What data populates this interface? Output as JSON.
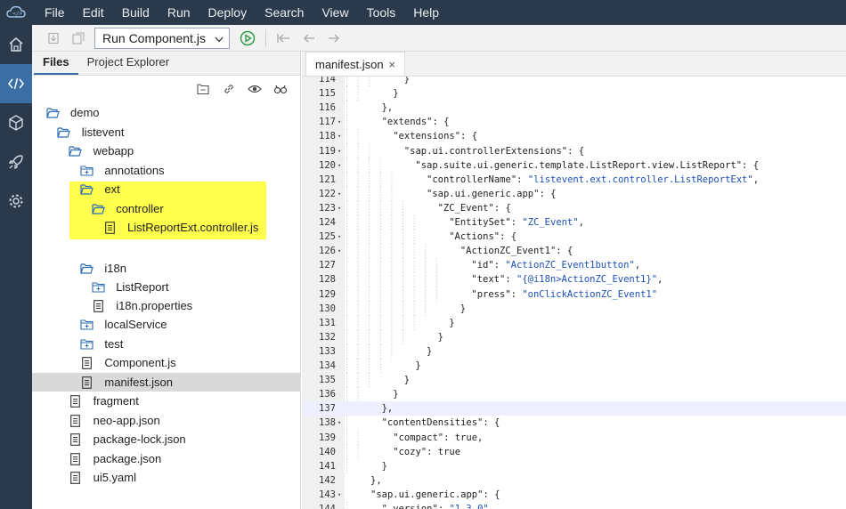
{
  "menu": [
    "File",
    "Edit",
    "Build",
    "Run",
    "Deploy",
    "Search",
    "View",
    "Tools",
    "Help"
  ],
  "toolbar": {
    "run_config": "Run Component.js"
  },
  "panel": {
    "tabs": [
      {
        "label": "Files",
        "active": true
      },
      {
        "label": "Project Explorer",
        "active": false
      }
    ]
  },
  "tree": [
    {
      "label": "demo",
      "depth": 0,
      "icon": "folder-open-icon"
    },
    {
      "label": "listevent",
      "depth": 1,
      "icon": "folder-open-icon"
    },
    {
      "label": "webapp",
      "depth": 2,
      "icon": "folder-open-icon"
    },
    {
      "label": "annotations",
      "depth": 3,
      "icon": "folder-closed-icon"
    },
    {
      "label": "ext",
      "depth": 3,
      "icon": "folder-open-icon",
      "highlight": true
    },
    {
      "label": "controller",
      "depth": 4,
      "icon": "folder-open-icon",
      "highlight": true
    },
    {
      "label": "ListReportExt.controller.js",
      "depth": 5,
      "icon": "file-icon",
      "highlight": true
    },
    {
      "label": "i18n",
      "depth": 3,
      "icon": "folder-open-icon",
      "gap": true
    },
    {
      "label": "ListReport",
      "depth": 4,
      "icon": "folder-closed-icon"
    },
    {
      "label": "i18n.properties",
      "depth": 4,
      "icon": "file-icon"
    },
    {
      "label": "localService",
      "depth": 3,
      "icon": "folder-closed-icon"
    },
    {
      "label": "test",
      "depth": 3,
      "icon": "folder-closed-icon"
    },
    {
      "label": "Component.js",
      "depth": 3,
      "icon": "file-icon"
    },
    {
      "label": "manifest.json",
      "depth": 3,
      "icon": "file-icon",
      "selected": true
    },
    {
      "label": "fragment",
      "depth": 2,
      "icon": "file-icon"
    },
    {
      "label": "neo-app.json",
      "depth": 2,
      "icon": "file-icon"
    },
    {
      "label": "package-lock.json",
      "depth": 2,
      "icon": "file-icon"
    },
    {
      "label": "package.json",
      "depth": 2,
      "icon": "file-icon"
    },
    {
      "label": "ui5.yaml",
      "depth": 2,
      "icon": "file-icon"
    }
  ],
  "editor": {
    "tab_label": "manifest.json",
    "close_glyph": "×",
    "lines": [
      {
        "n": "114",
        "indent": 6,
        "code": "}"
      },
      {
        "n": "115",
        "indent": 5,
        "code": "}"
      },
      {
        "n": "116",
        "indent": 4,
        "code": "},"
      },
      {
        "n": "117",
        "indent": 4,
        "code": "\"extends\": {",
        "fold": true
      },
      {
        "n": "118",
        "indent": 5,
        "code": "\"extensions\": {",
        "fold": true
      },
      {
        "n": "119",
        "indent": 6,
        "code": "\"sap.ui.controllerExtensions\": {",
        "fold": true
      },
      {
        "n": "120",
        "indent": 7,
        "code": "\"sap.suite.ui.generic.template.ListReport.view.ListReport\": {",
        "fold": true
      },
      {
        "n": "121",
        "indent": 8,
        "code": "\"controllerName\": \"listevent.ext.controller.ListReportExt\","
      },
      {
        "n": "122",
        "indent": 8,
        "code": "\"sap.ui.generic.app\": {",
        "fold": true
      },
      {
        "n": "123",
        "indent": 9,
        "code": "\"ZC_Event\": {",
        "fold": true
      },
      {
        "n": "124",
        "indent": 10,
        "code": "\"EntitySet\": \"ZC_Event\","
      },
      {
        "n": "125",
        "indent": 10,
        "code": "\"Actions\": {",
        "fold": true
      },
      {
        "n": "126",
        "indent": 11,
        "code": "\"ActionZC_Event1\": {",
        "fold": true
      },
      {
        "n": "127",
        "indent": 12,
        "code": "\"id\": \"ActionZC_Event1button\","
      },
      {
        "n": "128",
        "indent": 12,
        "code": "\"text\": \"{@i18n>ActionZC_Event1}\","
      },
      {
        "n": "129",
        "indent": 12,
        "code": "\"press\": \"onClickActionZC_Event1\""
      },
      {
        "n": "130",
        "indent": 11,
        "code": "}"
      },
      {
        "n": "131",
        "indent": 10,
        "code": "}"
      },
      {
        "n": "132",
        "indent": 9,
        "code": "}"
      },
      {
        "n": "133",
        "indent": 8,
        "code": "}"
      },
      {
        "n": "134",
        "indent": 7,
        "code": "}"
      },
      {
        "n": "135",
        "indent": 6,
        "code": "}"
      },
      {
        "n": "136",
        "indent": 5,
        "code": "}"
      },
      {
        "n": "137",
        "indent": 4,
        "code": "},",
        "active": true
      },
      {
        "n": "138",
        "indent": 4,
        "code": "\"contentDensities\": {",
        "fold": true
      },
      {
        "n": "139",
        "indent": 5,
        "code": "\"compact\": true,"
      },
      {
        "n": "140",
        "indent": 5,
        "code": "\"cozy\": true"
      },
      {
        "n": "141",
        "indent": 4,
        "code": "}"
      },
      {
        "n": "142",
        "indent": 3,
        "code": "},"
      },
      {
        "n": "143",
        "indent": 3,
        "code": "\"sap.ui.generic.app\": {",
        "fold": true
      },
      {
        "n": "144",
        "indent": 4,
        "code": "\"_version\": \"1.3.0\","
      }
    ]
  },
  "colors": {
    "chrome": "#2b3a4a",
    "accent": "#3a6ea5",
    "highlight": "#ffff4d",
    "string": "#1b4fb5"
  }
}
